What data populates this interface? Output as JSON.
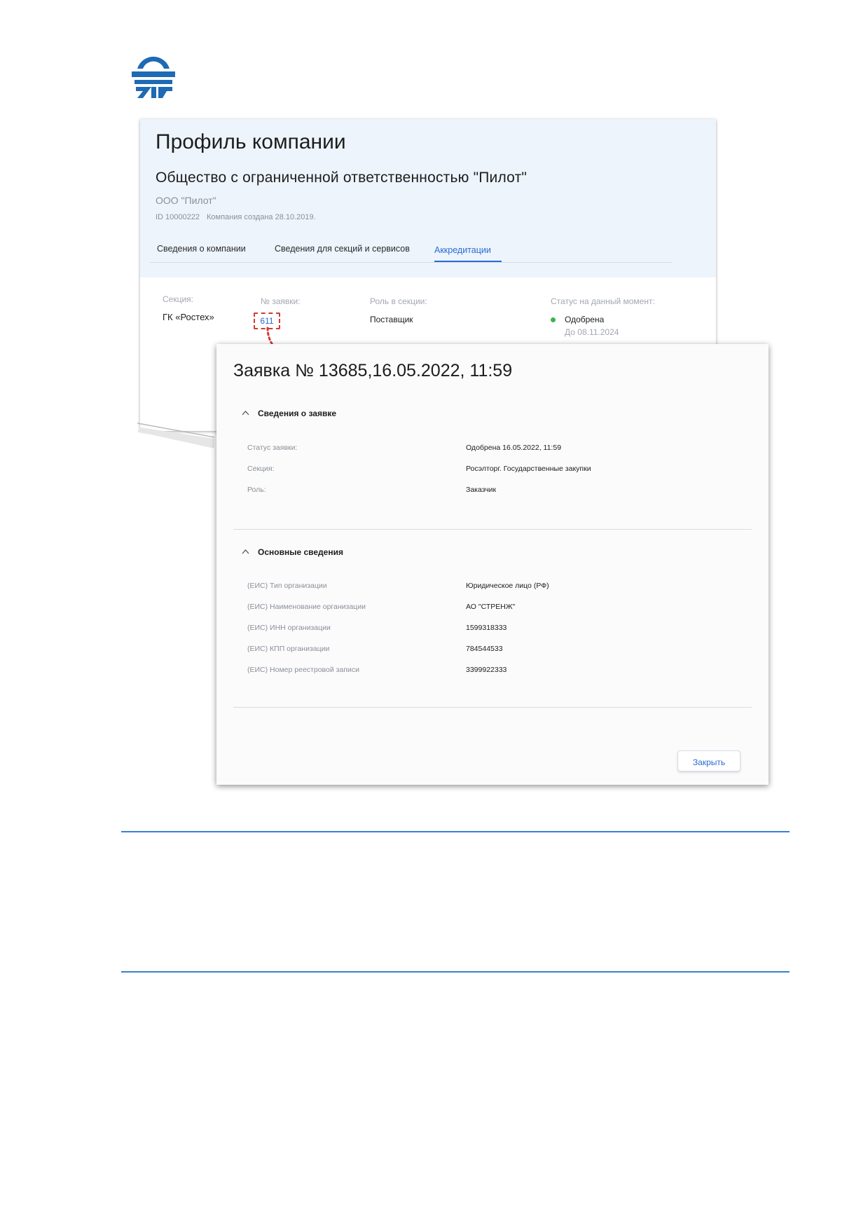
{
  "colors": {
    "accent": "#2a6bd1",
    "header_bg": "#edf4fc",
    "status_approved": "#39b54a",
    "highlight": "#d23a35",
    "logo": "#1e6ab4",
    "rule": "#3b7fd0"
  },
  "logo": {
    "icon": "company-logo-icon"
  },
  "profile": {
    "title": "Профиль компании",
    "org_full_name": "Общество с ограниченной ответственностью \"Пилот\"",
    "org_short_name": "ООО \"Пилот\"",
    "org_id": "ID 10000222",
    "created": "Компания создана 28.10.2019.",
    "tabs": [
      {
        "label": "Сведения о компании"
      },
      {
        "label": "Сведения для секций и сервисов"
      },
      {
        "label": "Аккредитации",
        "active": true
      }
    ],
    "accreditation": {
      "section_label": "Секция:",
      "section_value": "ГК «Ростех»",
      "request_label": "№ заявки:",
      "request_value": "611",
      "role_label": "Роль в секции:",
      "role_value": "Поставщик",
      "status_label": "Статус на данный момент:",
      "status_value": "Одобрена",
      "status_until": "До 08.11.2024"
    }
  },
  "modal": {
    "title": "Заявка № 13685,16.05.2022, 11:59",
    "section1": {
      "title": "Сведения о заявке",
      "rows": [
        {
          "label": "Статус заявки:",
          "value": "Одобрена 16.05.2022, 11:59"
        },
        {
          "label": "Секция:",
          "value": "Росэлторг. Государственные закупки"
        },
        {
          "label": "Роль:",
          "value": "Заказчик"
        }
      ]
    },
    "section2": {
      "title": "Основные сведения",
      "rows": [
        {
          "label": "(ЕИС) Тип организации",
          "value": "Юридическое лицо (РФ)"
        },
        {
          "label": "(ЕИС) Наименование организации",
          "value": "АО \"СТРЕНЖ\""
        },
        {
          "label": "(ЕИС) ИНН организации",
          "value": "1599318333"
        },
        {
          "label": "(ЕИС) КПП организации",
          "value": "784544533"
        },
        {
          "label": "(ЕИС) Номер реестровой записи",
          "value": "3399922333"
        }
      ]
    },
    "close_label": "Закрыть"
  }
}
